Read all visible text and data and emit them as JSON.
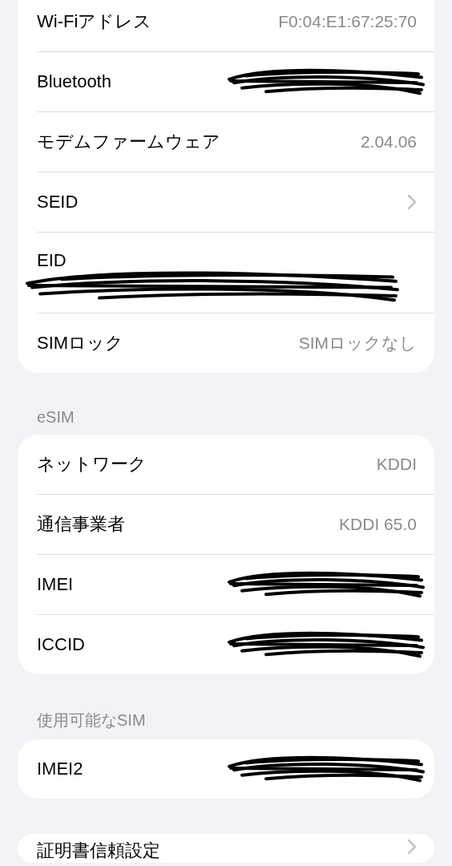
{
  "sections": [
    {
      "rows": [
        {
          "kind": "value",
          "label": "Wi-Fiアドレス",
          "value": "F0:04:E1:67:25:70"
        },
        {
          "kind": "redacted",
          "label": "Bluetooth"
        },
        {
          "kind": "value",
          "label": "モデムファームウェア",
          "value": "2.04.06"
        },
        {
          "kind": "chevron",
          "label": "SEID"
        },
        {
          "kind": "redacted_below",
          "label": "EID"
        },
        {
          "kind": "value",
          "label": "SIMロック",
          "value": "SIMロックなし"
        }
      ]
    },
    {
      "header": "eSIM",
      "rows": [
        {
          "kind": "value",
          "label": "ネットワーク",
          "value": "KDDI"
        },
        {
          "kind": "value",
          "label": "通信事業者",
          "value": "KDDI 65.0"
        },
        {
          "kind": "redacted",
          "label": "IMEI"
        },
        {
          "kind": "redacted",
          "label": "ICCID"
        }
      ]
    },
    {
      "header": "使用可能なSIM",
      "rows": [
        {
          "kind": "redacted",
          "label": "IMEI2"
        }
      ]
    },
    {
      "rows": [
        {
          "kind": "chevron",
          "label": "証明書信頼設定"
        }
      ]
    }
  ]
}
